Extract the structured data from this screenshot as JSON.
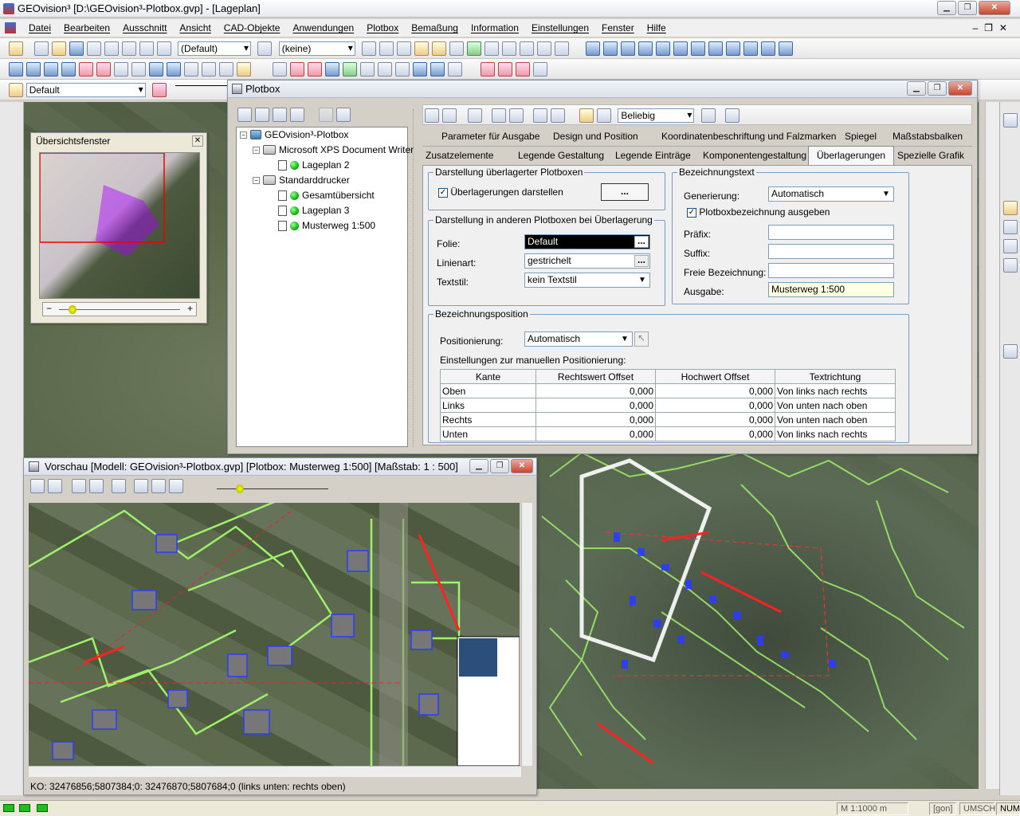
{
  "app": {
    "title": "GEOvision³  [D:\\GEOvision³-Plotbox.gvp] - [Lageplan]"
  },
  "menu": [
    "Datei",
    "Bearbeiten",
    "Ausschnitt",
    "Ansicht",
    "CAD-Objekte",
    "Anwendungen",
    "Plotbox",
    "Bemaßung",
    "Information",
    "Einstellungen",
    "Fenster",
    "Hilfe"
  ],
  "toolbar": {
    "style_combo": "(Default)",
    "layer_combo": "(keine)",
    "default_combo": "Default"
  },
  "overview": {
    "title": "Übersichtsfenster",
    "minus": "−",
    "plus": "+"
  },
  "plotbox": {
    "title": "Plotbox",
    "filter_combo": "Beliebig",
    "tree": [
      {
        "label": "GEOvision³-Plotbox",
        "kind": "root"
      },
      {
        "label": "Microsoft XPS Document Writer",
        "kind": "printer"
      },
      {
        "label": "Lageplan 2",
        "kind": "plot"
      },
      {
        "label": "Standarddrucker",
        "kind": "printer"
      },
      {
        "label": "Gesamtübersicht",
        "kind": "plot"
      },
      {
        "label": "Lageplan 3",
        "kind": "plot"
      },
      {
        "label": "Musterweg 1:500",
        "kind": "plot"
      }
    ],
    "tabs_row1": [
      "Parameter für Ausgabe",
      "Design und Position",
      "Koordinatenbeschriftung und Falzmarken",
      "Spiegel",
      "Maßstabsbalken"
    ],
    "tabs_row2": [
      "Zusatzelemente",
      "Legende Gestaltung",
      "Legende Einträge",
      "Komponentengestaltung",
      "Überlagerungen",
      "Spezielle Grafik"
    ],
    "active_tab": "Überlagerungen",
    "g1": {
      "title": "Darstellung überlagerter Plotboxen",
      "checkbox": "Überlagerungen darstellen",
      "button": "..."
    },
    "g2": {
      "title": "Darstellung in anderen Plotboxen bei Überlagerung",
      "folie_label": "Folie:",
      "folie_value": "Default",
      "linienart_label": "Linienart:",
      "linienart_value": "gestrichelt",
      "textstil_label": "Textstil:",
      "textstil_value": "kein Textstil"
    },
    "g3": {
      "title": "Bezeichnungstext",
      "gen_label": "Generierung:",
      "gen_value": "Automatisch",
      "checkbox": "Plotboxbezeichnung ausgeben",
      "praefix": "Präfix:",
      "suffix": "Suffix:",
      "freie": "Freie Bezeichnung:",
      "ausgabe": "Ausgabe:",
      "ausgabe_value": "Musterweg 1:500"
    },
    "g4": {
      "title": "Bezeichnungsposition",
      "pos_label": "Positionierung:",
      "pos_value": "Automatisch",
      "manual_label": "Einstellungen zur manuellen Positionierung:",
      "columns": [
        "Kante",
        "Rechtswert Offset",
        "Hochwert Offset",
        "Textrichtung"
      ],
      "rows": [
        [
          "Oben",
          "0,000",
          "0,000",
          "Von links nach rechts"
        ],
        [
          "Links",
          "0,000",
          "0,000",
          "Von unten nach oben"
        ],
        [
          "Rechts",
          "0,000",
          "0,000",
          "Von unten nach oben"
        ],
        [
          "Unten",
          "0,000",
          "0,000",
          "Von links nach rechts"
        ]
      ]
    }
  },
  "preview": {
    "title": "Vorschau [Modell: GEOvision³-Plotbox.gvp] [Plotbox: Musterweg 1:500] [Maßstab: 1 : 500]",
    "status": "KO: 32476856;5807384;0: 32476870;5807684;0 (links unten: rechts oben)"
  },
  "statusbar": {
    "scale": "M 1:1000  m",
    "unit": "[gon]",
    "umsch": "UMSCH",
    "num": "NUM"
  },
  "colors": {
    "active_input": "#000000",
    "ausgabe_bg": "#ffffe1",
    "parcel_line": "#9ff06a",
    "building": "#2a3cff"
  }
}
